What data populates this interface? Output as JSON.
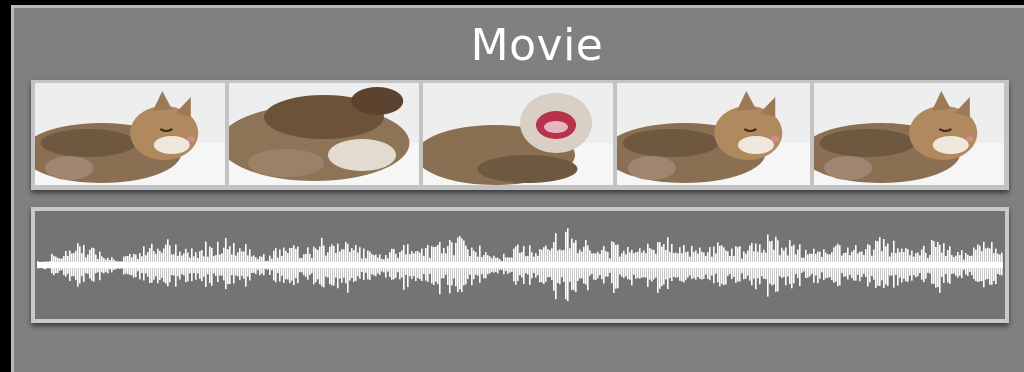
{
  "title": "Movie",
  "thumbnails": [
    {
      "name": "cat-sleeping-1",
      "pose": "sleep"
    },
    {
      "name": "cat-paws-up",
      "pose": "paws"
    },
    {
      "name": "cat-yawning",
      "pose": "yawn"
    },
    {
      "name": "cat-sleeping-paw-forward",
      "pose": "sleep"
    },
    {
      "name": "cat-sleeping-2",
      "pose": "sleep"
    }
  ],
  "audio_bursts": [
    {
      "at": 0.05,
      "amp": 0.55,
      "w": 0.035
    },
    {
      "at": 0.13,
      "amp": 0.62,
      "w": 0.04
    },
    {
      "at": 0.19,
      "amp": 0.7,
      "w": 0.045
    },
    {
      "at": 0.26,
      "amp": 0.55,
      "w": 0.03
    },
    {
      "at": 0.31,
      "amp": 0.72,
      "w": 0.04
    },
    {
      "at": 0.38,
      "amp": 0.58,
      "w": 0.035
    },
    {
      "at": 0.43,
      "amp": 0.75,
      "w": 0.045
    },
    {
      "at": 0.51,
      "amp": 0.6,
      "w": 0.035
    },
    {
      "at": 0.55,
      "amp": 1.0,
      "w": 0.03
    },
    {
      "at": 0.6,
      "amp": 0.62,
      "w": 0.035
    },
    {
      "at": 0.65,
      "amp": 0.7,
      "w": 0.045
    },
    {
      "at": 0.71,
      "amp": 0.62,
      "w": 0.035
    },
    {
      "at": 0.76,
      "amp": 0.78,
      "w": 0.04
    },
    {
      "at": 0.82,
      "amp": 0.6,
      "w": 0.035
    },
    {
      "at": 0.87,
      "amp": 0.75,
      "w": 0.045
    },
    {
      "at": 0.93,
      "amp": 0.6,
      "w": 0.035
    },
    {
      "at": 0.98,
      "amp": 0.62,
      "w": 0.02
    }
  ],
  "colors": {
    "panel": "#808080",
    "waveform_bg": "#747474",
    "waveform": "#ffffff",
    "filmstrip_border": "#c3c3c3"
  }
}
